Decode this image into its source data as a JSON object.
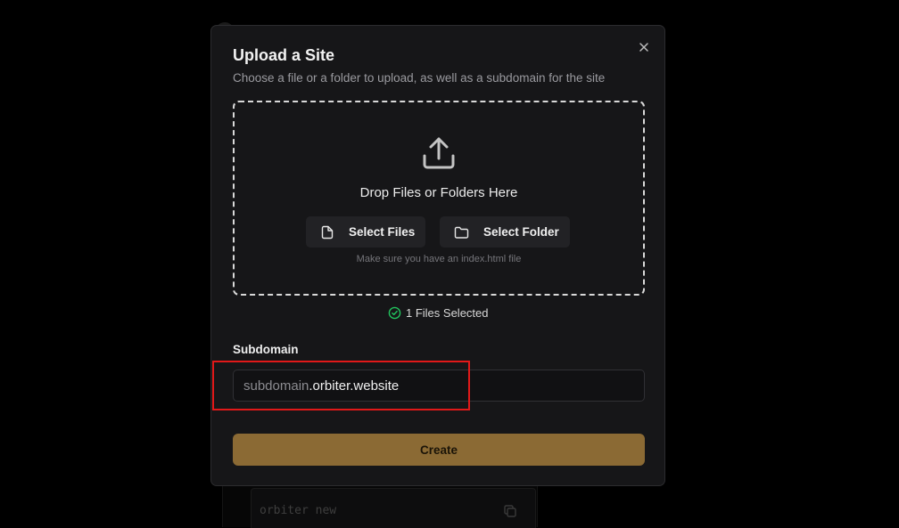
{
  "background": {
    "command": "orbiter new"
  },
  "modal": {
    "title": "Upload a Site",
    "description": "Choose a file or a folder to upload, as well as a subdomain for the site",
    "dropzone": {
      "text": "Drop Files or Folders Here",
      "select_files_label": "Select Files",
      "select_folder_label": "Select Folder",
      "hint": "Make sure you have an index.html file"
    },
    "selection_status": "1 Files Selected",
    "subdomain": {
      "label": "Subdomain",
      "placeholder": "subdomain",
      "suffix": ".orbiter.website",
      "value": ""
    },
    "create_label": "Create"
  },
  "colors": {
    "accent": "#8b6a34",
    "success": "#22c55e",
    "highlight": "#e11919"
  },
  "icons": {
    "close": "close-icon",
    "upload": "upload-icon",
    "file": "file-icon",
    "folder": "folder-icon",
    "check": "check-circle-icon",
    "copy": "copy-icon"
  }
}
